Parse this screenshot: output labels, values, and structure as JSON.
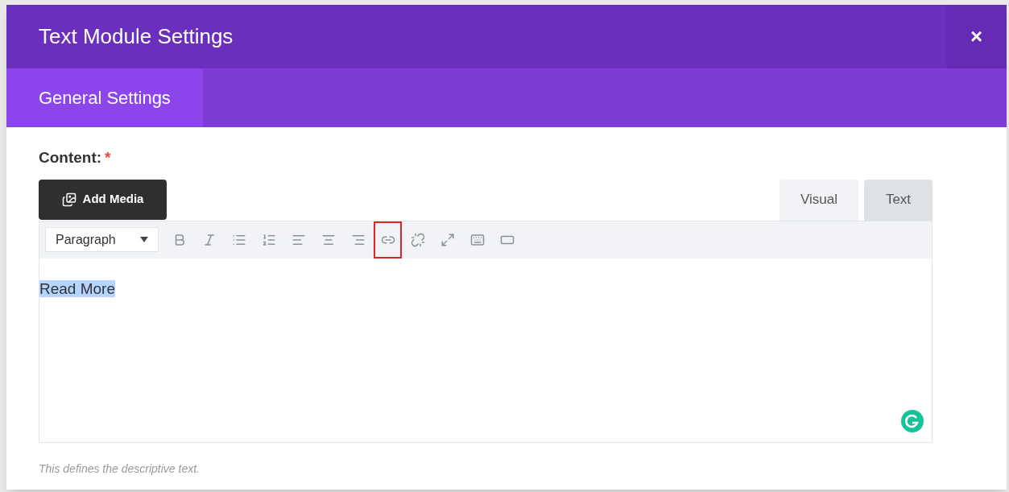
{
  "window": {
    "title": "Text Module Settings",
    "close": "×"
  },
  "tabs": [
    {
      "label": "General Settings",
      "selected": true
    }
  ],
  "field": {
    "label": "Content:",
    "required_mark": "*",
    "add_media": "Add Media",
    "editor_tabs": [
      {
        "label": "Visual",
        "selected": true
      },
      {
        "label": "Text",
        "selected": false
      }
    ],
    "format_select": {
      "value": "Paragraph"
    },
    "toolbar": [
      {
        "kind": "bold",
        "highlighted": false
      },
      {
        "kind": "italic",
        "highlighted": false
      },
      {
        "kind": "bullets",
        "highlighted": false
      },
      {
        "kind": "numbers",
        "highlighted": false
      },
      {
        "kind": "align-left",
        "highlighted": false
      },
      {
        "kind": "align-center",
        "highlighted": false
      },
      {
        "kind": "align-right",
        "highlighted": false
      },
      {
        "kind": "link",
        "highlighted": true
      },
      {
        "kind": "unlink",
        "highlighted": false
      },
      {
        "kind": "fullscreen",
        "highlighted": false
      },
      {
        "kind": "keyboard",
        "highlighted": false
      },
      {
        "kind": "button",
        "highlighted": false
      }
    ],
    "content": {
      "text": "Read More",
      "selected": true
    },
    "description": "This defines the descriptive text."
  }
}
